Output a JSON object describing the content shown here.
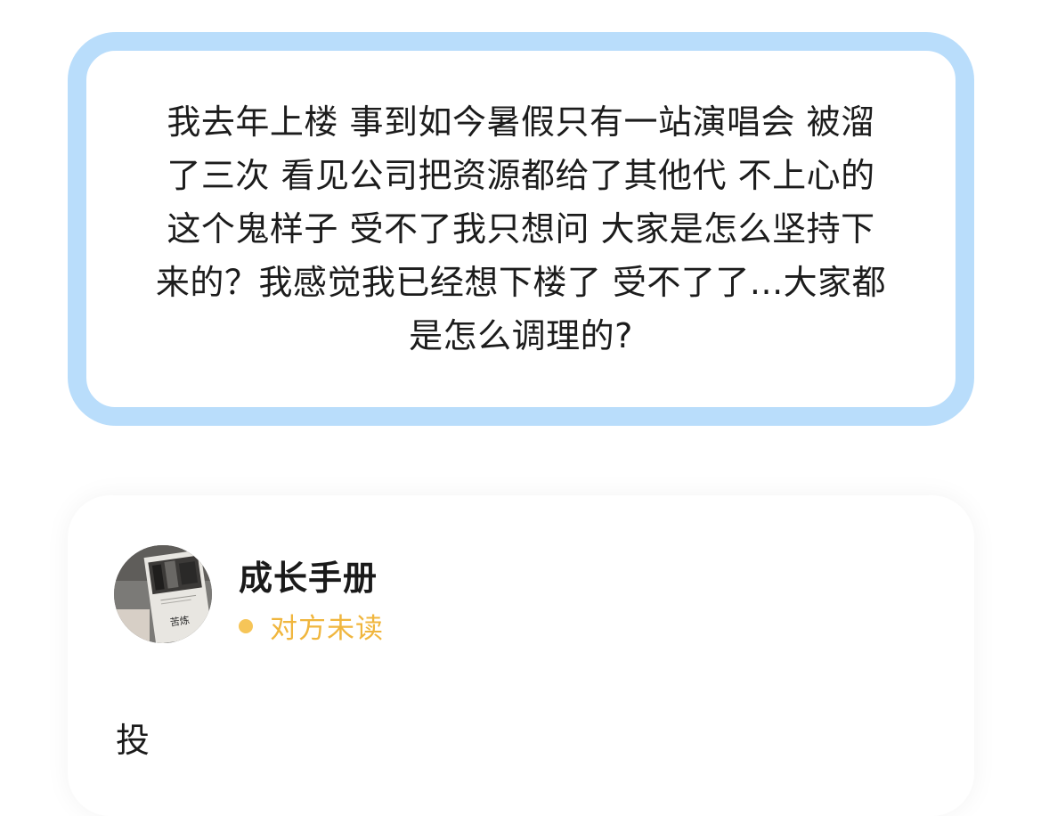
{
  "question": {
    "lines": [
      "我去年上楼 事到如今暑假只有一站演唱会 被溜",
      "了三次 看见公司把资源都给了其他代 不上心的",
      "这个鬼样子 受不了我只想问 大家是怎么坚持下",
      "来的？我感觉我已经想下楼了 受不了了...大家都",
      "是怎么调理的?"
    ]
  },
  "answer": {
    "author": "成长手册",
    "avatar_book_title": "苦炼",
    "status": "对方未读",
    "body": "投"
  },
  "colors": {
    "question_border": "#b9ddfb",
    "status_dot": "#f6c558",
    "status_text": "#f0b63e"
  }
}
